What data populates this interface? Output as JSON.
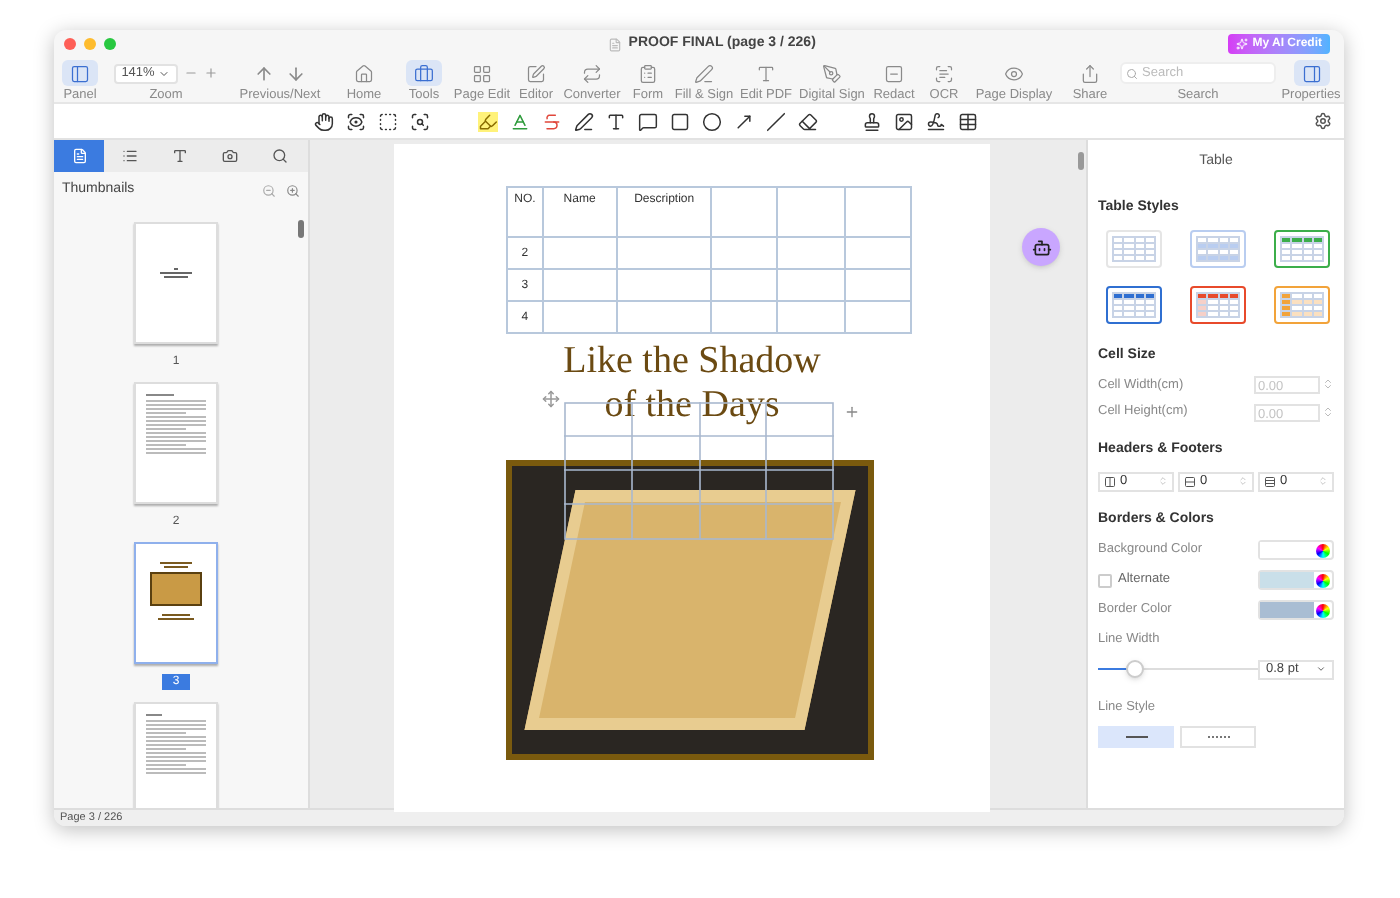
{
  "window": {
    "title": "PROOF FINAL (page 3 / 226)",
    "ai_button": "My AI Credit"
  },
  "toolbar": {
    "items": [
      {
        "kind": "button",
        "label": "Panel",
        "selected": true
      },
      {
        "kind": "zoom",
        "label": "Zoom",
        "value": "141%"
      },
      {
        "kind": "nav",
        "label": "Previous/Next"
      },
      {
        "kind": "button",
        "label": "Home",
        "selected": false
      },
      {
        "kind": "button",
        "label": "Tools",
        "selected": true
      },
      {
        "kind": "button",
        "label": "Page Edit",
        "selected": false
      },
      {
        "kind": "button",
        "label": "Editor",
        "selected": false
      },
      {
        "kind": "button",
        "label": "Converter",
        "selected": false
      },
      {
        "kind": "button",
        "label": "Form",
        "selected": false
      },
      {
        "kind": "button",
        "label": "Fill & Sign",
        "selected": false
      },
      {
        "kind": "button",
        "label": "Edit PDF",
        "selected": false
      },
      {
        "kind": "button",
        "label": "Digital Sign",
        "selected": false
      },
      {
        "kind": "button",
        "label": "Redact",
        "selected": false
      },
      {
        "kind": "button",
        "label": "OCR",
        "selected": false
      },
      {
        "kind": "button",
        "label": "Page Display",
        "selected": false
      },
      {
        "kind": "button",
        "label": "Share",
        "selected": false
      },
      {
        "kind": "search",
        "label": "Search",
        "placeholder": "Search"
      },
      {
        "kind": "button",
        "label": "Properties",
        "selected": true
      }
    ]
  },
  "sidebar": {
    "tabs": [
      {
        "selected": true
      },
      {
        "selected": false
      },
      {
        "selected": false
      },
      {
        "selected": false
      },
      {
        "selected": false
      }
    ],
    "title": "Thumbnails",
    "pages": [
      {
        "kind": "title",
        "label": "1",
        "selected": false
      },
      {
        "kind": "text",
        "label": "2",
        "selected": false
      },
      {
        "kind": "image",
        "label": "3",
        "selected": true
      },
      {
        "kind": "contents",
        "selected": false
      }
    ]
  },
  "document": {
    "table": {
      "columns": [
        "NO.",
        "Name",
        "Description"
      ],
      "rows": [
        [
          "2"
        ],
        [
          "3"
        ],
        [
          "4"
        ]
      ]
    },
    "title_lines": [
      "Like the Shadow",
      "of the Days"
    ]
  },
  "properties": {
    "title": "Table",
    "table_styles": {
      "title": "Table Styles",
      "styles": [
        {
          "kind": "plain"
        },
        {
          "kind": "banded",
          "color": "#b9cdf0"
        },
        {
          "kind": "header",
          "color": "#3cae4a"
        },
        {
          "kind": "header",
          "color": "#2f6fd1"
        },
        {
          "kind": "header_column",
          "color": "#e84a2b"
        },
        {
          "kind": "first_column",
          "color": "#f2a33a"
        }
      ]
    },
    "cell_size": {
      "title": "Cell Size",
      "fields": [
        {
          "label": "Cell Width(cm)",
          "value": "0.00",
          "disabled": true
        },
        {
          "label": "Cell Height(cm)",
          "value": "0.00",
          "disabled": true
        }
      ]
    },
    "headers_footers": {
      "title": "Headers & Footers",
      "fields": [
        {
          "value": "0"
        },
        {
          "value": "0"
        },
        {
          "value": "0"
        }
      ]
    },
    "borders_colors": {
      "title": "Borders & Colors",
      "background": {
        "label": "Background Color",
        "color": "#ffffff"
      },
      "alternate": {
        "label": "Alternate",
        "checked": false,
        "color": "#c9dfe9"
      },
      "border": {
        "label": "Border Color",
        "color": "#a9bdd3"
      },
      "line_width": {
        "label": "Line Width",
        "level": 0.22,
        "value": "0.8 pt"
      },
      "line_style": {
        "label": "Line Style",
        "options": [
          {
            "kind": "solid",
            "selected": true
          },
          {
            "kind": "dotted",
            "selected": false
          }
        ]
      }
    }
  },
  "status_bar": {
    "text": "Page 3 / 226"
  }
}
